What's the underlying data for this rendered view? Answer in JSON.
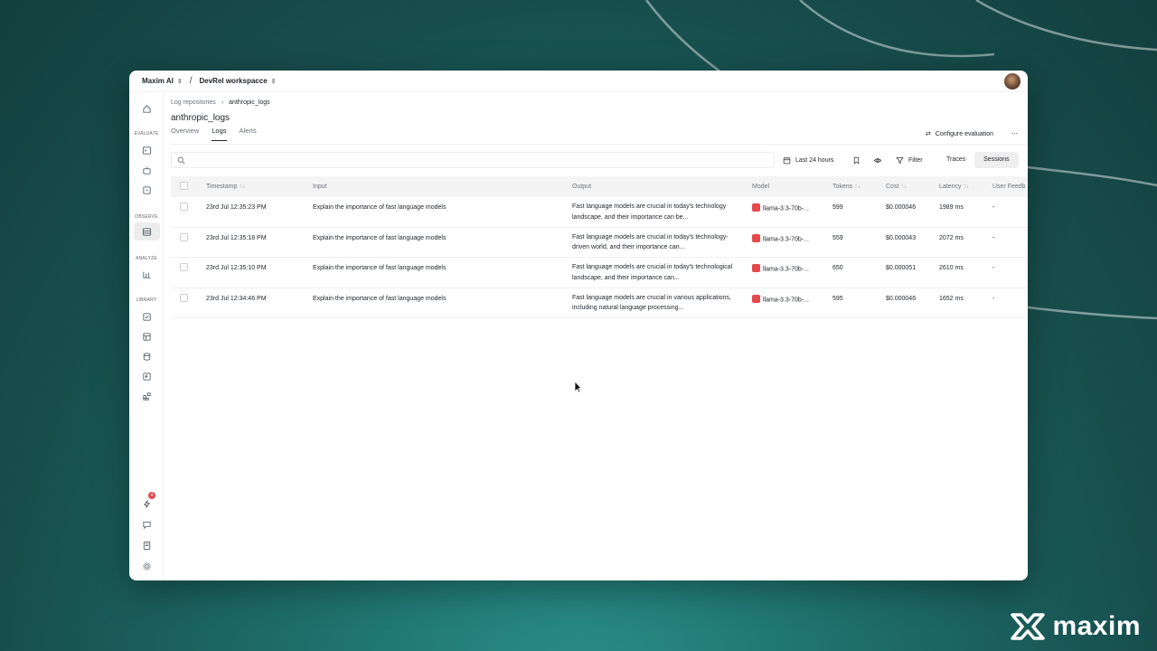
{
  "topbar": {
    "org": "Maxim AI",
    "workspace": "DevRel workspacce",
    "separator": "/"
  },
  "sidebar": {
    "sections": [
      "EVALUATE",
      "OBSERVE",
      "ANALYZE",
      "LIBRARY"
    ],
    "notification_count": "4"
  },
  "breadcrumb": {
    "parent": "Log repositories",
    "current": "anthropic_logs"
  },
  "page": {
    "title": "anthropic_logs",
    "tabs": [
      "Overview",
      "Logs",
      "Alerts"
    ],
    "active_tab": "Logs",
    "configure_label": "Configure evaluation",
    "more_label": "···"
  },
  "toolbar": {
    "search_placeholder": "",
    "time_range": "Last 24 hours",
    "filter_label": "Filter",
    "view_options": [
      "Traces",
      "Sessions"
    ],
    "active_view": "Sessions"
  },
  "table": {
    "columns": [
      "Timestamp",
      "Input",
      "Output",
      "Model",
      "Tokens",
      "Cost",
      "Latency",
      "User Feedb"
    ],
    "rows": [
      {
        "timestamp": "23rd Jul 12:35:23 PM",
        "input": "Explain the importance of fast language models",
        "output": "Fast language models are crucial in today's technology landscape, and their importance can be...",
        "model": "llama-3.3-70b-...",
        "tokens": "599",
        "cost": "$0.000046",
        "latency": "1989 ms",
        "feedback": "-"
      },
      {
        "timestamp": "23rd Jul 12:35:18 PM",
        "input": "Explain the importance of fast language models",
        "output": "Fast language models are crucial in today's technology-driven world, and their importance can...",
        "model": "llama-3.3-70b-...",
        "tokens": "559",
        "cost": "$0.000043",
        "latency": "2072 ms",
        "feedback": "-"
      },
      {
        "timestamp": "23rd Jul 12:35:10 PM",
        "input": "Explain the importance of fast language models",
        "output": "Fast language models are crucial in today's technological landscape, and their importance can...",
        "model": "llama-3.3-70b-...",
        "tokens": "650",
        "cost": "$0.000051",
        "latency": "2610 ms",
        "feedback": "-"
      },
      {
        "timestamp": "23rd Jul 12:34:46 PM",
        "input": "Explain the importance of fast language models",
        "output": "Fast language models are crucial in various applications, including natural language processing...",
        "model": "llama-3.3-70b-...",
        "tokens": "595",
        "cost": "$0.000046",
        "latency": "1652 ms",
        "feedback": "-"
      }
    ]
  },
  "brand": {
    "word": "maxim"
  },
  "colors": {
    "background": "#1e6e6a",
    "badge": "#e5484d",
    "text": "#1f2328"
  }
}
